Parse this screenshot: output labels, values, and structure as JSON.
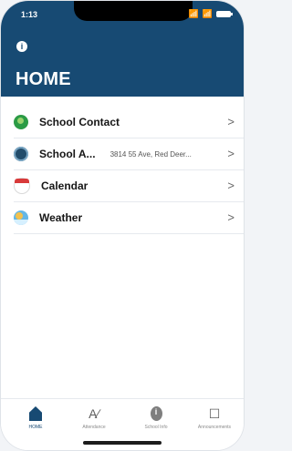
{
  "status_bar": {
    "time": "1:13",
    "right": "📶 📶"
  },
  "header": {
    "info_glyph": "i",
    "title": "HOME"
  },
  "list": [
    {
      "label": "School Contact",
      "detail": "",
      "chevron": ">"
    },
    {
      "label": "School A...",
      "detail": "3814 55 Ave, Red Deer...",
      "chevron": ">"
    },
    {
      "label": "Calendar",
      "detail": "",
      "chevron": ">"
    },
    {
      "label": "Weather",
      "detail": "",
      "chevron": ">"
    }
  ],
  "tabbar": [
    {
      "label": "HOME",
      "glyph": "",
      "active": true
    },
    {
      "label": "Attendance",
      "glyph": "A∕",
      "active": false
    },
    {
      "label": "School Info",
      "glyph": "i",
      "active": false
    },
    {
      "label": "Announcements",
      "glyph": "☐",
      "active": false
    }
  ],
  "colors": {
    "header": "#174a73",
    "active_tab": "#174a73"
  }
}
